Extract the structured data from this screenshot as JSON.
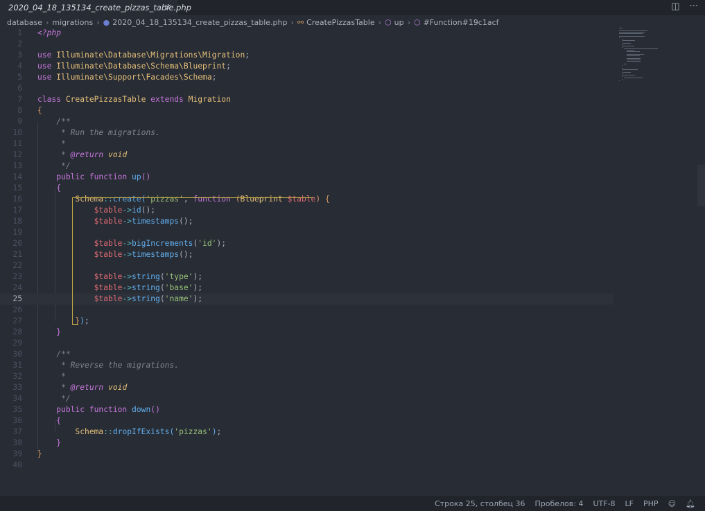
{
  "tab": {
    "file_name": "2020_04_18_135134_create_pizzas_table.php",
    "close_glyph": "×",
    "split_icon": "split-editor-icon",
    "more_icon": "more-icon"
  },
  "breadcrumbs": [
    {
      "label": "database",
      "icon": ""
    },
    {
      "label": "migrations",
      "icon": ""
    },
    {
      "label": "2020_04_18_135134_create_pizzas_table.php",
      "icon": "php-file-icon"
    },
    {
      "label": "CreatePizzasTable",
      "icon": "class-icon"
    },
    {
      "label": "up",
      "icon": "method-icon"
    },
    {
      "label": "#Function#19c1acf",
      "icon": "method-icon"
    }
  ],
  "code": {
    "lines": [
      {
        "n": "1",
        "t": [
          [
            "tag",
            "<?php"
          ]
        ]
      },
      {
        "n": "2",
        "t": []
      },
      {
        "n": "3",
        "t": [
          [
            "kw",
            "use "
          ],
          [
            "cls",
            "Illuminate\\Database\\Migrations\\Migration"
          ],
          [
            "pun",
            ";"
          ]
        ]
      },
      {
        "n": "4",
        "t": [
          [
            "kw",
            "use "
          ],
          [
            "cls",
            "Illuminate\\Database\\Schema\\Blueprint"
          ],
          [
            "pun",
            ";"
          ]
        ]
      },
      {
        "n": "5",
        "t": [
          [
            "kw",
            "use "
          ],
          [
            "cls",
            "Illuminate\\Support\\Facades\\Schema"
          ],
          [
            "pun",
            ";"
          ]
        ]
      },
      {
        "n": "6",
        "t": []
      },
      {
        "n": "7",
        "t": [
          [
            "kw",
            "class "
          ],
          [
            "cls",
            "CreatePizzasTable "
          ],
          [
            "kw",
            "extends "
          ],
          [
            "cls",
            "Migration"
          ]
        ]
      },
      {
        "n": "8",
        "t": [
          [
            "br1",
            "{"
          ]
        ]
      },
      {
        "n": "9",
        "t": [
          [
            "pun",
            "    "
          ],
          [
            "cm",
            "/**"
          ]
        ]
      },
      {
        "n": "10",
        "t": [
          [
            "pun",
            "    "
          ],
          [
            "cm",
            " * Run the migrations."
          ]
        ]
      },
      {
        "n": "11",
        "t": [
          [
            "pun",
            "    "
          ],
          [
            "cm",
            " *"
          ]
        ]
      },
      {
        "n": "12",
        "t": [
          [
            "pun",
            "    "
          ],
          [
            "cm",
            " * "
          ],
          [
            "tag",
            "@return "
          ],
          [
            "typ",
            "void"
          ]
        ]
      },
      {
        "n": "13",
        "t": [
          [
            "pun",
            "    "
          ],
          [
            "cm",
            " */"
          ]
        ]
      },
      {
        "n": "14",
        "t": [
          [
            "pun",
            "    "
          ],
          [
            "kw",
            "public function "
          ],
          [
            "fn",
            "up"
          ],
          [
            "br2",
            "()"
          ]
        ]
      },
      {
        "n": "15",
        "t": [
          [
            "pun",
            "    "
          ],
          [
            "br2",
            "{"
          ]
        ]
      },
      {
        "n": "16",
        "t": [
          [
            "pun",
            "        "
          ],
          [
            "cls",
            "Schema"
          ],
          [
            "op",
            "::"
          ],
          [
            "fn",
            "create"
          ],
          [
            "br3",
            "("
          ],
          [
            "str",
            "'pizzas'"
          ],
          [
            "pun",
            ", "
          ],
          [
            "kw",
            "function "
          ],
          [
            "br1",
            "("
          ],
          [
            "cls",
            "Blueprint "
          ],
          [
            "var",
            "$table"
          ],
          [
            "br1",
            ")"
          ],
          [
            "pun",
            " "
          ],
          [
            "br1",
            "{"
          ]
        ]
      },
      {
        "n": "17",
        "t": [
          [
            "pun",
            "            "
          ],
          [
            "var",
            "$table"
          ],
          [
            "op",
            "->"
          ],
          [
            "fn",
            "id"
          ],
          [
            "pun",
            "();"
          ]
        ]
      },
      {
        "n": "18",
        "t": [
          [
            "pun",
            "            "
          ],
          [
            "var",
            "$table"
          ],
          [
            "op",
            "->"
          ],
          [
            "fn",
            "timestamps"
          ],
          [
            "pun",
            "();"
          ]
        ]
      },
      {
        "n": "19",
        "t": []
      },
      {
        "n": "20",
        "t": [
          [
            "pun",
            "            "
          ],
          [
            "var",
            "$table"
          ],
          [
            "op",
            "->"
          ],
          [
            "fn",
            "bigIncrements"
          ],
          [
            "pun",
            "("
          ],
          [
            "str",
            "'id'"
          ],
          [
            "pun",
            ");"
          ]
        ]
      },
      {
        "n": "21",
        "t": [
          [
            "pun",
            "            "
          ],
          [
            "var",
            "$table"
          ],
          [
            "op",
            "->"
          ],
          [
            "fn",
            "timestamps"
          ],
          [
            "pun",
            "();"
          ]
        ]
      },
      {
        "n": "22",
        "t": []
      },
      {
        "n": "23",
        "t": [
          [
            "pun",
            "            "
          ],
          [
            "var",
            "$table"
          ],
          [
            "op",
            "->"
          ],
          [
            "fn",
            "string"
          ],
          [
            "pun",
            "("
          ],
          [
            "str",
            "'type'"
          ],
          [
            "pun",
            ");"
          ]
        ]
      },
      {
        "n": "24",
        "t": [
          [
            "pun",
            "            "
          ],
          [
            "var",
            "$table"
          ],
          [
            "op",
            "->"
          ],
          [
            "fn",
            "string"
          ],
          [
            "pun",
            "("
          ],
          [
            "str",
            "'base'"
          ],
          [
            "pun",
            ");"
          ]
        ]
      },
      {
        "n": "25",
        "t": [
          [
            "pun",
            "            "
          ],
          [
            "var",
            "$table"
          ],
          [
            "op",
            "->"
          ],
          [
            "fn",
            "string"
          ],
          [
            "pun",
            "("
          ],
          [
            "str",
            "'name'"
          ],
          [
            "pun",
            ");"
          ]
        ]
      },
      {
        "n": "26",
        "t": []
      },
      {
        "n": "27",
        "t": [
          [
            "pun",
            "        "
          ],
          [
            "br1",
            "}"
          ],
          [
            "br3",
            ")"
          ],
          [
            "pun",
            ";"
          ]
        ]
      },
      {
        "n": "28",
        "t": [
          [
            "pun",
            "    "
          ],
          [
            "br2",
            "}"
          ]
        ]
      },
      {
        "n": "29",
        "t": []
      },
      {
        "n": "30",
        "t": [
          [
            "pun",
            "    "
          ],
          [
            "cm",
            "/**"
          ]
        ]
      },
      {
        "n": "31",
        "t": [
          [
            "pun",
            "    "
          ],
          [
            "cm",
            " * Reverse the migrations."
          ]
        ]
      },
      {
        "n": "32",
        "t": [
          [
            "pun",
            "    "
          ],
          [
            "cm",
            " *"
          ]
        ]
      },
      {
        "n": "33",
        "t": [
          [
            "pun",
            "    "
          ],
          [
            "cm",
            " * "
          ],
          [
            "tag",
            "@return "
          ],
          [
            "typ",
            "void"
          ]
        ]
      },
      {
        "n": "34",
        "t": [
          [
            "pun",
            "    "
          ],
          [
            "cm",
            " */"
          ]
        ]
      },
      {
        "n": "35",
        "t": [
          [
            "pun",
            "    "
          ],
          [
            "kw",
            "public function "
          ],
          [
            "fn",
            "down"
          ],
          [
            "br2",
            "()"
          ]
        ]
      },
      {
        "n": "36",
        "t": [
          [
            "pun",
            "    "
          ],
          [
            "br2",
            "{"
          ]
        ]
      },
      {
        "n": "37",
        "t": [
          [
            "pun",
            "        "
          ],
          [
            "cls",
            "Schema"
          ],
          [
            "op",
            "::"
          ],
          [
            "fn",
            "dropIfExists"
          ],
          [
            "br3",
            "("
          ],
          [
            "str",
            "'pizzas'"
          ],
          [
            "br3",
            ")"
          ],
          [
            "pun",
            ";"
          ]
        ]
      },
      {
        "n": "38",
        "t": [
          [
            "pun",
            "    "
          ],
          [
            "br2",
            "}"
          ]
        ]
      },
      {
        "n": "39",
        "t": [
          [
            "br1",
            "}"
          ]
        ]
      },
      {
        "n": "40",
        "t": []
      }
    ],
    "current_line": "25"
  },
  "statusbar": {
    "position": "Строка 25, столбец 36",
    "spaces": "Пробелов: 4",
    "encoding": "UTF-8",
    "eol": "LF",
    "language": "PHP",
    "feedback_icon": "feedback-icon",
    "bell_icon": "bell-icon"
  }
}
